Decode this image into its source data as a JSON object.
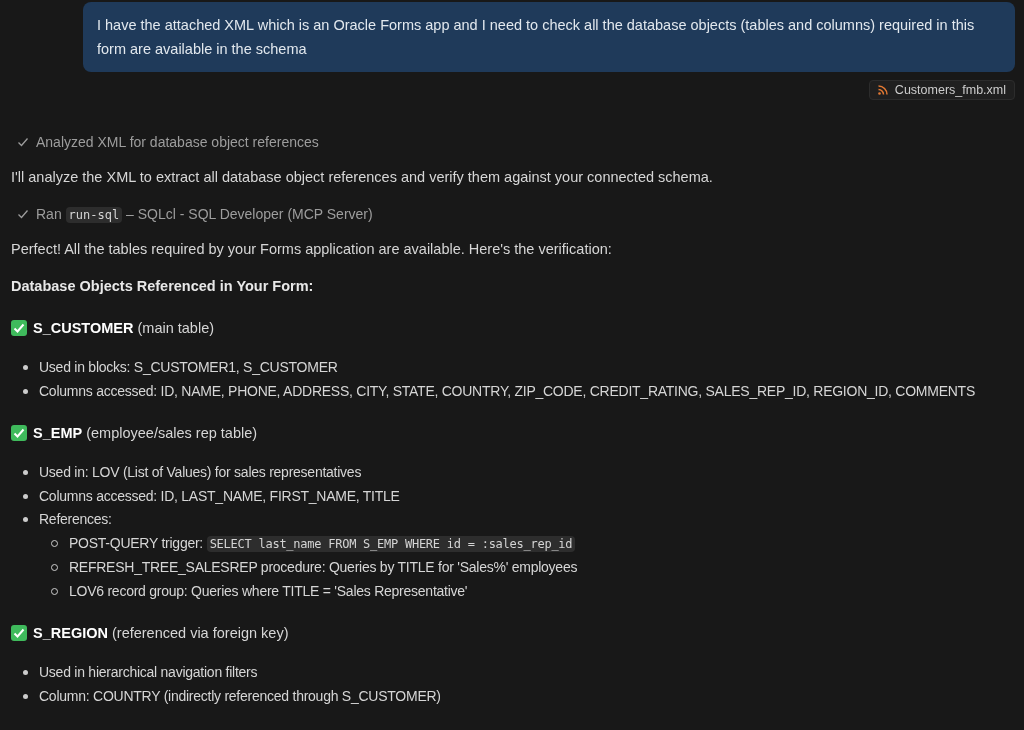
{
  "user_message": {
    "text": "I have the attached XML which is an Oracle Forms app and I need to check all the database objects (tables and columns) required in this form are available in the schema",
    "attachment": "Customers_fmb.xml"
  },
  "response": [
    {
      "kind": "step",
      "done": true,
      "text": "Analyzed XML for database object references"
    },
    {
      "kind": "paragraph",
      "text": "I'll analyze the XML to extract all database object references and verify them against your connected schema."
    },
    {
      "kind": "step",
      "done": true,
      "text": "Ran",
      "code": "run-sql",
      "after": "– SQLcl - SQL Developer (MCP Server)"
    },
    {
      "kind": "paragraph",
      "text": "Perfect! All the tables required by your Forms application are available. Here's the verification:"
    },
    {
      "kind": "heading",
      "text": "Database Objects Referenced in Your Form:"
    },
    {
      "kind": "object",
      "checked": true,
      "name": "S_CUSTOMER",
      "note": "(main table)",
      "items": [
        {
          "text": "Used in blocks: S_CUSTOMER1, S_CUSTOMER"
        },
        {
          "text": "Columns accessed: ID, NAME, PHONE, ADDRESS, CITY, STATE, COUNTRY, ZIP_CODE, CREDIT_RATING, SALES_REP_ID, REGION_ID, COMMENTS"
        }
      ]
    },
    {
      "kind": "object",
      "checked": true,
      "name": "S_EMP",
      "note": "(employee/sales rep table)",
      "items": [
        {
          "text": "Used in: LOV (List of Values) for sales representatives"
        },
        {
          "text": "Columns accessed: ID, LAST_NAME, FIRST_NAME, TITLE"
        },
        {
          "text": "References:",
          "children": [
            {
              "text": "POST-QUERY trigger:",
              "code": "SELECT last_name FROM S_EMP WHERE id = :sales_rep_id"
            },
            {
              "text": "REFRESH_TREE_SALESREP procedure: Queries by TITLE for 'Sales%' employees"
            },
            {
              "text": "LOV6 record group: Queries where TITLE = 'Sales Representative'"
            }
          ]
        }
      ]
    },
    {
      "kind": "object",
      "checked": true,
      "name": "S_REGION",
      "note": "(referenced via foreign key)",
      "items": [
        {
          "text": "Used in hierarchical navigation filters"
        },
        {
          "text": "Column: COUNTRY (indirectly referenced through S_CUSTOMER)"
        }
      ]
    }
  ]
}
